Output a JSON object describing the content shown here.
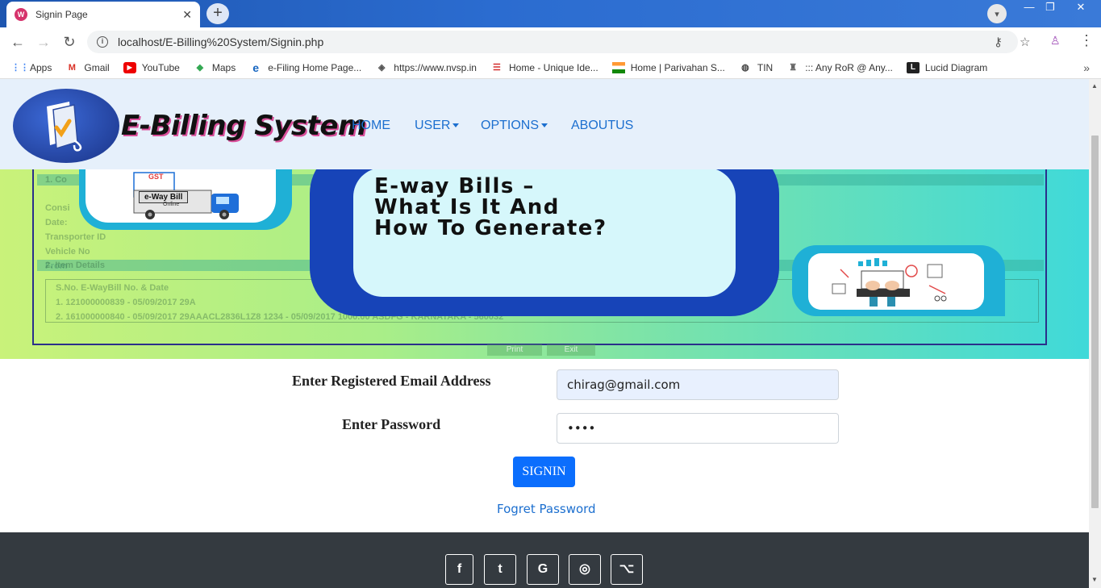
{
  "browser": {
    "tab_title": "Signin Page",
    "tab_close": "✕",
    "new_tab": "+",
    "url": "localhost/E-Billing%20System/Signin.php",
    "bookmarks": [
      {
        "label": "Apps",
        "icon": "apps-grid-icon"
      },
      {
        "label": "Gmail",
        "icon": "gmail-icon"
      },
      {
        "label": "YouTube",
        "icon": "youtube-icon"
      },
      {
        "label": "Maps",
        "icon": "maps-icon"
      },
      {
        "label": "e-Filing Home Page...",
        "icon": "efiling-icon"
      },
      {
        "label": "https://www.nvsp.in",
        "icon": "nvsp-icon"
      },
      {
        "label": "Home - Unique Ide...",
        "icon": "aadhaar-icon"
      },
      {
        "label": "Home | Parivahan S...",
        "icon": "india-flag-icon"
      },
      {
        "label": "TIN",
        "icon": "globe-icon"
      },
      {
        "label": "::: Any RoR @ Any...",
        "icon": "emblem-icon"
      },
      {
        "label": "Lucid Diagram",
        "icon": "lucid-icon"
      }
    ],
    "bookmarks_more": "»"
  },
  "navbar": {
    "brand": "E-Billing System",
    "links": {
      "home": "HOME",
      "user": "USER",
      "options": "OPTIONS",
      "aboutus": "ABOUTUS"
    }
  },
  "banner": {
    "headline_1": "E-way Bills –",
    "headline_2": "What Is It And",
    "headline_3": "How To Generate?",
    "gst_label": "GST",
    "eway_label": "e-Way Bill",
    "eway_sub": "Online",
    "print_btn": "Print",
    "exit_btn": "Exit",
    "doc_section_1": "1. Co",
    "doc_section_2": "2. Item Details",
    "doc_rows": [
      "Consi",
      "Date:",
      "Transporter ID",
      "Vehicle No",
      "From"
    ],
    "doc_header": "S.No.      E-WayBill No. & Date",
    "doc_line_1": "1.          121000000839 - 05/09/2017            29A",
    "doc_line_2": "2.          161000000840 - 05/09/2017            29AAACL2836L1Z8          1234 - 05/09/2017               1000.00        ASDFG - KARNATAKA - 560032"
  },
  "form": {
    "email_label": "Enter Registered Email Address",
    "email_value": "chirag@gmail.com",
    "password_label": "Enter Password",
    "password_value": "••••",
    "signin_label": "SIGNIN",
    "forgot_label": "Fogret Password"
  },
  "footer": {
    "social": [
      {
        "name": "facebook-icon",
        "glyph": "f"
      },
      {
        "name": "twitter-icon",
        "glyph": "t"
      },
      {
        "name": "google-icon",
        "glyph": "G"
      },
      {
        "name": "instagram-icon",
        "glyph": "◎"
      },
      {
        "name": "github-icon",
        "glyph": "⌥"
      }
    ]
  }
}
